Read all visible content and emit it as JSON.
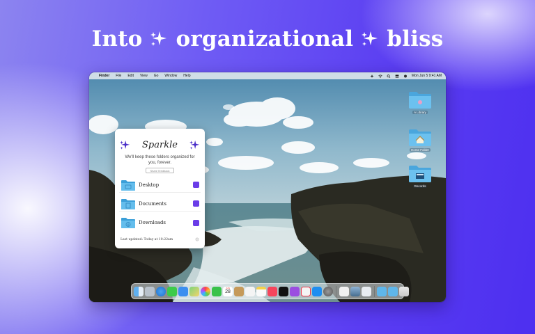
{
  "headline": {
    "part1": "Into",
    "part2": "organizational",
    "part3": "bliss"
  },
  "menubar": {
    "apple": "",
    "items": [
      "Finder",
      "File",
      "Edit",
      "View",
      "Go",
      "Window",
      "Help"
    ],
    "clock": "Mon Jun 5  9:41 AM"
  },
  "desktop_icons": [
    {
      "label": "A Library",
      "icon": "folder-icon"
    },
    {
      "label": "Home Folder",
      "icon": "home-folder-icon"
    },
    {
      "label": "Records",
      "icon": "news-folder-icon"
    }
  ],
  "panel": {
    "title": "Sparkle",
    "tagline": "We'll keep these folders organized for you, forever.",
    "share_label": "Share feedback",
    "folders": [
      {
        "name": "Desktop",
        "checked": true
      },
      {
        "name": "Documents",
        "checked": true
      },
      {
        "name": "Downloads",
        "checked": true
      }
    ],
    "last_updated": "Last updated: Today at 10:22am"
  },
  "dock": {
    "calendar_month": "JUN",
    "calendar_day": "28",
    "apps": [
      "finder",
      "launchpad",
      "safari",
      "messages",
      "mail",
      "maps",
      "photos",
      "facetime",
      "calendar",
      "contacts",
      "reminders",
      "notes",
      "music",
      "tv",
      "podcasts",
      "news",
      "app-store",
      "settings",
      "pages",
      "preview",
      "sparkle",
      "folder",
      "trash"
    ]
  },
  "colors": {
    "accent": "#6a3ce8",
    "folder": "#5cb7ea"
  }
}
